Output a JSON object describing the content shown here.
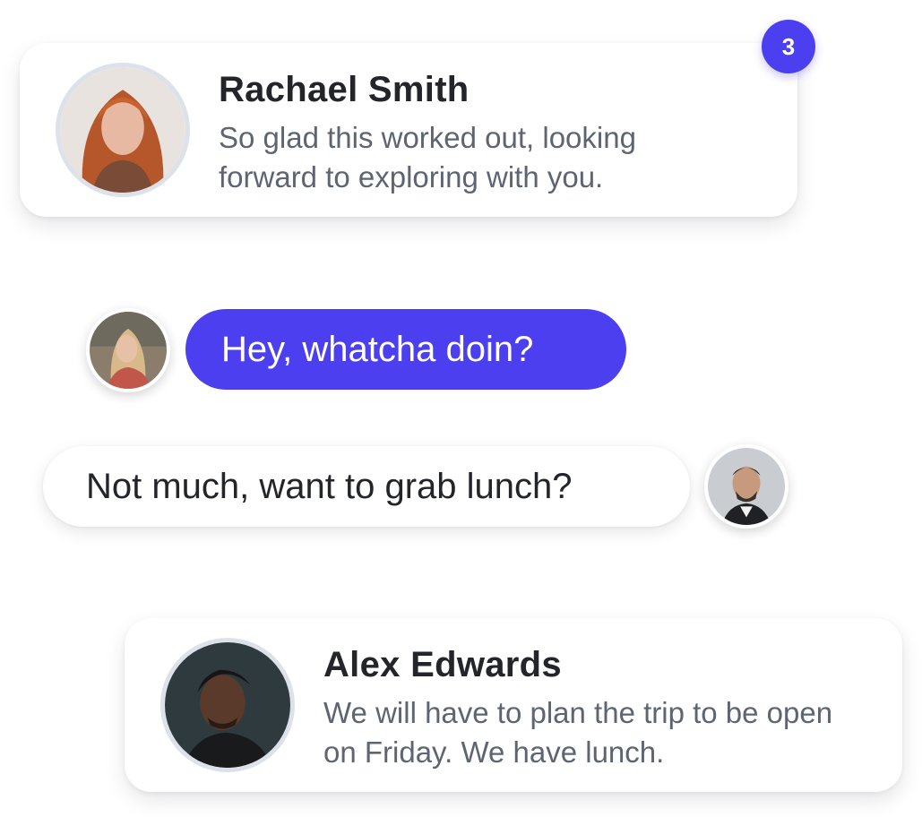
{
  "conversations": [
    {
      "name": "Rachael Smith",
      "message": "So glad this worked out, looking forward to exploring with you.",
      "unread_count": "3"
    },
    {
      "name": "Alex Edwards",
      "message": "We will have to plan the trip to be open on Friday. We have lunch."
    }
  ],
  "chat": [
    {
      "direction": "sent",
      "text": "Hey, whatcha doin?"
    },
    {
      "direction": "received",
      "text": "Not much, want to grab lunch?"
    }
  ],
  "colors": {
    "accent": "#4b3ff0",
    "name_text": "#23252b",
    "message_text": "#5d6572",
    "avatar_ring": "#dde2ea"
  },
  "icons": [
    "avatar-rachael-smith",
    "avatar-sender",
    "avatar-receiver",
    "avatar-alex-edwards"
  ]
}
